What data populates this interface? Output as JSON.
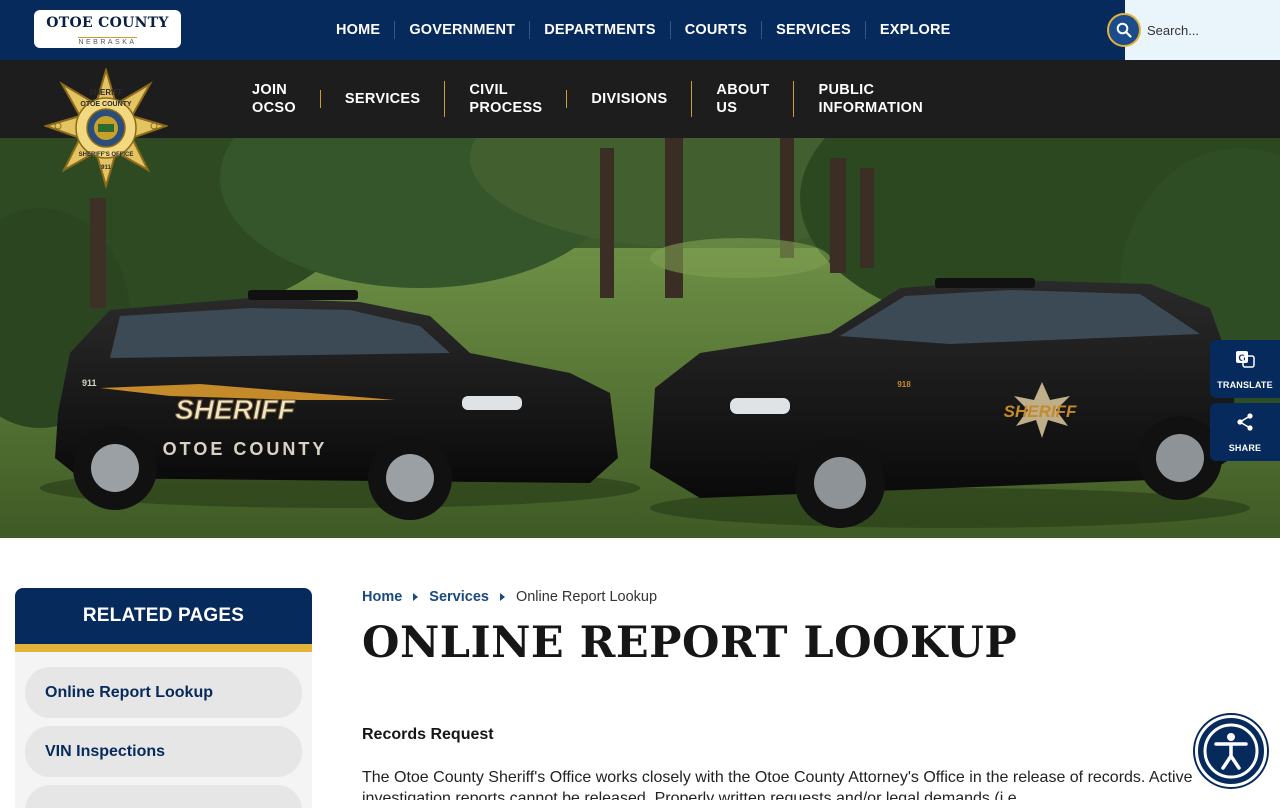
{
  "header": {
    "logo": {
      "line1": "OTOE COUNTY",
      "line2": "NEBRASKA"
    },
    "nav": [
      "HOME",
      "GOVERNMENT",
      "DEPARTMENTS",
      "COURTS",
      "SERVICES",
      "EXPLORE"
    ],
    "search": {
      "placeholder": "Search..."
    }
  },
  "dept_nav": {
    "items": [
      {
        "line1": "JOIN",
        "line2": "OCSO"
      },
      {
        "line1": "SERVICES",
        "line2": ""
      },
      {
        "line1": "CIVIL",
        "line2": "PROCESS"
      },
      {
        "line1": "DIVISIONS",
        "line2": ""
      },
      {
        "line1": "ABOUT",
        "line2": "US"
      },
      {
        "line1": "PUBLIC",
        "line2": "INFORMATION"
      }
    ],
    "badge": {
      "top": "SHERIFF",
      "mid": "OTOE COUNTY",
      "bottom": "SHERIFF'S OFFICE",
      "num": "911"
    }
  },
  "hero": {
    "vehicle_left": {
      "label": "SHERIFF",
      "sub": "OTOE COUNTY",
      "num": "911"
    },
    "vehicle_right": {
      "label": "SHERIFF",
      "num": "918"
    }
  },
  "side_tools": {
    "translate": "TRANSLATE",
    "share": "SHARE"
  },
  "sidebar": {
    "title": "RELATED PAGES",
    "links": [
      "Online Report Lookup",
      "VIN Inspections"
    ]
  },
  "breadcrumb": {
    "home": "Home",
    "section": "Services",
    "current": "Online Report Lookup"
  },
  "content": {
    "title": "ONLINE REPORT LOOKUP",
    "subheading": "Records Request",
    "paragraph": "The Otoe County Sheriff's Office works closely with the Otoe County Attorney's Office in the release of records. Active investigation reports cannot be released. Properly written requests and/or legal demands (i.e."
  },
  "colors": {
    "navy": "#072a5c",
    "gold": "#e2b33b",
    "dark": "#1d1d1d"
  }
}
